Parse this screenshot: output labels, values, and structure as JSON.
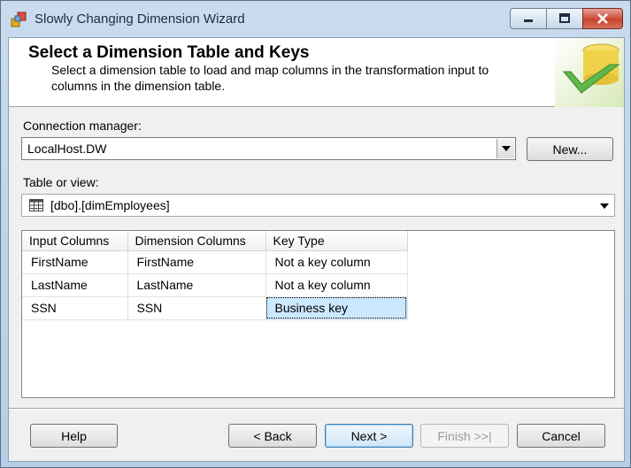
{
  "window": {
    "title": "Slowly Changing Dimension Wizard",
    "icon": "ssis-wizard-icon"
  },
  "caption_buttons": {
    "minimize": "minimize-icon",
    "maximize": "maximize-icon",
    "close": "close-icon"
  },
  "banner": {
    "title": "Select a Dimension Table and Keys",
    "description": "Select a dimension table to load and map columns in the transformation input to columns in the dimension table."
  },
  "connection": {
    "label": "Connection manager:",
    "value": "LocalHost.DW",
    "new_button": "New..."
  },
  "table_or_view": {
    "label": "Table or view:",
    "value": "[dbo].[dimEmployees]",
    "icon": "table-icon"
  },
  "mapping": {
    "columns": [
      "Input Columns",
      "Dimension Columns",
      "Key Type"
    ],
    "rows": [
      [
        "FirstName",
        "FirstName",
        "Not a key column"
      ],
      [
        "LastName",
        "LastName",
        "Not a key column"
      ],
      [
        "SSN",
        "SSN",
        "Business key"
      ]
    ],
    "selected_row": 2
  },
  "buttons": {
    "help": "Help",
    "back": "< Back",
    "next": "Next >",
    "finish": "Finish >>|",
    "cancel": "Cancel"
  },
  "colors": {
    "selection": "#cce8ff",
    "default_button_border": "#3c7fb1",
    "close_button": "#c9452f"
  }
}
